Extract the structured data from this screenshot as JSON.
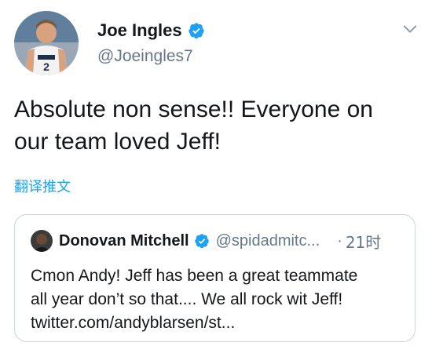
{
  "tweet": {
    "author": {
      "display_name": "Joe Ingles",
      "handle": "@Joeingles7",
      "verified": true,
      "avatar_icon": "avatar-player-photo"
    },
    "menu_icon": "chevron-down-icon",
    "text_lines": [
      "Absolute non sense!! Everyone on",
      "our team loved Jeff!"
    ],
    "translate_label": "翻译推文",
    "quoted": {
      "display_name": "Donovan Mitchell",
      "handle": "@spidadmitc...",
      "separator": "·",
      "time": "21时",
      "verified": true,
      "text_lines": [
        "Cmon Andy! Jeff has been a great teammate",
        "all year don’t so that.... We all rock wit Jeff!",
        "twitter.com/andyblarsen/st..."
      ]
    }
  },
  "colors": {
    "link": "#1da1f2",
    "verified": "#1da1f2",
    "secondary_text": "#657786",
    "border": "#ccd6dd"
  }
}
